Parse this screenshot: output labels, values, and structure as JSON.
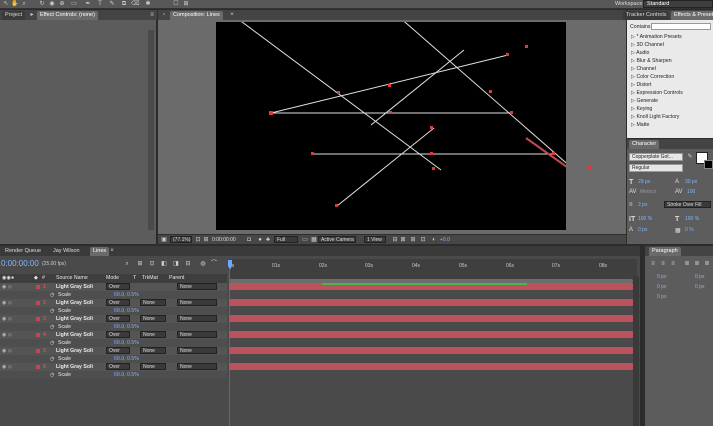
{
  "top": {
    "workspace_label": "Workspace:",
    "workspace_value": "Standard"
  },
  "left_panel": {
    "tabs": [
      "Project",
      "Effect Controls: (none)"
    ]
  },
  "comp_panel": {
    "tab": "Composition: Lines",
    "footer": {
      "zoom": "(77.1%)",
      "timecode": "0:00:00:00",
      "resolution": "Full",
      "camera": "Active Camera",
      "view": "1 View",
      "exposure": "+0.0"
    }
  },
  "effects_panel": {
    "tabs": [
      "Tracker Controls",
      "Effects & Presets"
    ],
    "search_label": "Contains:",
    "items": [
      "* Animation Presets",
      "3D Channel",
      "Audio",
      "Blur & Sharpen",
      "Channel",
      "Color Correction",
      "Distort",
      "Expression Controls",
      "Generate",
      "Keying",
      "Knoll Light Factory",
      "Matte"
    ]
  },
  "character_panel": {
    "tab": "Character",
    "font": "Copperplate Got...",
    "style": "Regular",
    "size": "29 px",
    "leading": "30 px",
    "tracking_label": "Metrics",
    "tracking": "100",
    "stroke_width": "2 px",
    "stroke_mode": "Stroke Over Fill",
    "vscale": "100 %",
    "hscale": "100 %",
    "baseline": "0 px",
    "tsume": "0 %"
  },
  "paragraph_panel": {
    "tab": "Paragraph",
    "fields": [
      "0 px",
      "0 px",
      "0 px",
      "0 px",
      "0 px"
    ]
  },
  "timeline": {
    "tabs": [
      "Render Queue",
      "Jay Wilson",
      "Lines"
    ],
    "timecode": "0:00:00:00",
    "fps": "(25.00 fps)",
    "columns": {
      "num": "#",
      "source": "Source Name",
      "mode": "Mode",
      "t": "T",
      "trkmat": "TrkMat",
      "parent": "Parent"
    },
    "ruler": [
      "0s",
      "01s",
      "02s",
      "03s",
      "04s",
      "05s",
      "06s",
      "07s",
      "08s"
    ],
    "layers": [
      {
        "num": "1",
        "name": "Light Gray Soli",
        "mode": "Over",
        "trkmat": "",
        "parent": "None",
        "prop": "Scale",
        "value": "69.0, 0.5%"
      },
      {
        "num": "2",
        "name": "Light Gray Soli",
        "mode": "Over",
        "trkmat": "None",
        "parent": "None",
        "prop": "Scale",
        "value": "69.0, 0.5%"
      },
      {
        "num": "3",
        "name": "Light Gray Soli",
        "mode": "Over",
        "trkmat": "None",
        "parent": "None",
        "prop": "Scale",
        "value": "69.0, 0.5%"
      },
      {
        "num": "4",
        "name": "Light Gray Soli",
        "mode": "Over",
        "trkmat": "None",
        "parent": "None",
        "prop": "Scale",
        "value": "69.0, 0.5%"
      },
      {
        "num": "5",
        "name": "Light Gray Soli",
        "mode": "Over",
        "trkmat": "None",
        "parent": "None",
        "prop": "Scale",
        "value": "69.0, 0.5%"
      },
      {
        "num": "6",
        "name": "Light Gray Soli",
        "mode": "Over",
        "trkmat": "None",
        "parent": "None",
        "prop": "Scale",
        "value": "69.0, 0.5%"
      }
    ]
  },
  "colors": {
    "layer_bar": "#bb535c",
    "work_area": "#49b54b",
    "playhead": "#d03a3a",
    "keyframe": "#e23a3a"
  }
}
